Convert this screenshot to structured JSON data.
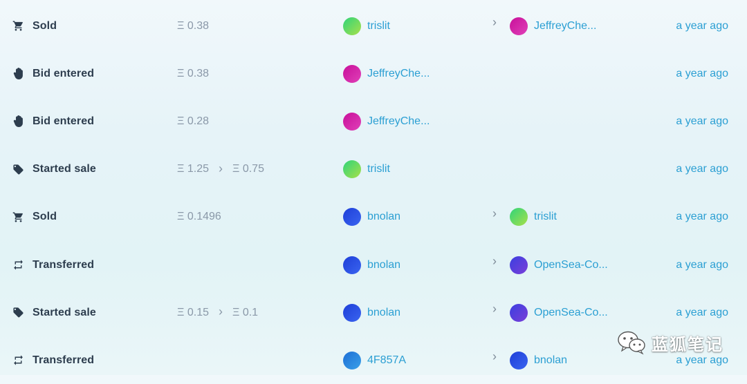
{
  "icons": {
    "cart": "shopping-cart-icon",
    "hand": "hand-icon",
    "tag": "price-tag-icon",
    "transfer": "transfer-icon"
  },
  "avatar_colors": {
    "trislit": [
      "#2fd47a",
      "#a8e04a"
    ],
    "JeffreyChe": [
      "#c8109a",
      "#e040b8"
    ],
    "bnolan": [
      "#1e3fd8",
      "#3a64f0"
    ],
    "OpenSea": [
      "#3b3fe0",
      "#7a3fd8"
    ],
    "4F857A": [
      "#1d6fd6",
      "#3aa0e8"
    ]
  },
  "rows": [
    {
      "event": "Sold",
      "icon": "cart",
      "price": "Ξ 0.38",
      "price_to": "",
      "from": "trislit",
      "from_avatar": "trislit",
      "to": "JeffreyChe...",
      "to_avatar": "JeffreyChe",
      "time": "a year ago"
    },
    {
      "event": "Bid entered",
      "icon": "hand",
      "price": "Ξ 0.38",
      "price_to": "",
      "from": "JeffreyChe...",
      "from_avatar": "JeffreyChe",
      "to": "",
      "to_avatar": "",
      "time": "a year ago"
    },
    {
      "event": "Bid entered",
      "icon": "hand",
      "price": "Ξ 0.28",
      "price_to": "",
      "from": "JeffreyChe...",
      "from_avatar": "JeffreyChe",
      "to": "",
      "to_avatar": "",
      "time": "a year ago"
    },
    {
      "event": "Started sale",
      "icon": "tag",
      "price": "Ξ 1.25",
      "price_to": "Ξ 0.75",
      "from": "trislit",
      "from_avatar": "trislit",
      "to": "",
      "to_avatar": "",
      "time": "a year ago"
    },
    {
      "event": "Sold",
      "icon": "cart",
      "price": "Ξ 0.1496",
      "price_to": "",
      "from": "bnolan",
      "from_avatar": "bnolan",
      "to": "trislit",
      "to_avatar": "trislit",
      "time": "a year ago"
    },
    {
      "event": "Transferred",
      "icon": "transfer",
      "price": "",
      "price_to": "",
      "from": "bnolan",
      "from_avatar": "bnolan",
      "to": "OpenSea-Co...",
      "to_avatar": "OpenSea",
      "time": "a year ago"
    },
    {
      "event": "Started sale",
      "icon": "tag",
      "price": "Ξ 0.15",
      "price_to": "Ξ 0.1",
      "from": "bnolan",
      "from_avatar": "bnolan",
      "to": "OpenSea-Co...",
      "to_avatar": "OpenSea",
      "time": "a year ago"
    },
    {
      "event": "Transferred",
      "icon": "transfer",
      "price": "",
      "price_to": "",
      "from": "4F857A",
      "from_avatar": "4F857A",
      "to": "bnolan",
      "to_avatar": "bnolan",
      "time": "a year ago"
    }
  ],
  "watermark": {
    "text": "蓝狐笔记",
    "icon": "wechat-icon"
  }
}
